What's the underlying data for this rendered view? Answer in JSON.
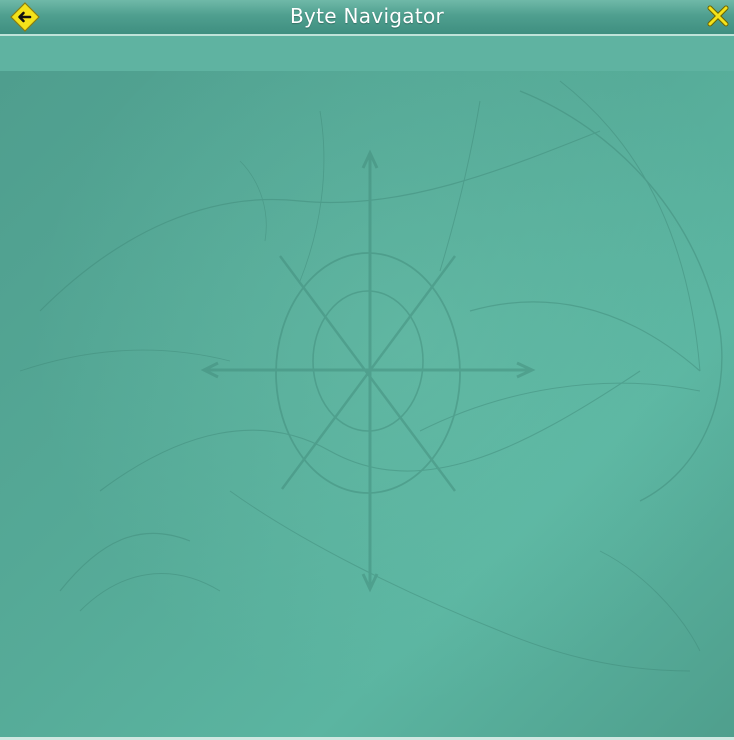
{
  "window": {
    "title": "Byte Navigator"
  },
  "titlebar": {
    "back_icon": "arrow-left-icon",
    "close_icon": "close-x-icon"
  },
  "colors": {
    "accent_yellow": "#f4e21a",
    "titlebar_teal": "#4f9f8f",
    "content_teal": "#56ab98"
  }
}
